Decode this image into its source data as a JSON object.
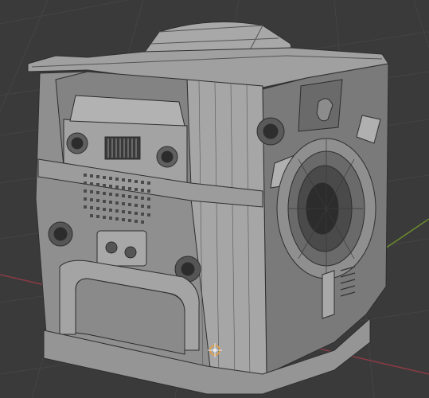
{
  "viewport": {
    "background": "#3a3a3a",
    "grid_color": "#444444",
    "axis_x_color": "#8a3b45",
    "axis_y_color": "#6b8a2e"
  },
  "model": {
    "body_color": "#9a9a9a",
    "body_light": "#b4b4b4",
    "body_dark": "#6e6e6e",
    "wire_color": "#2e2e2e"
  },
  "origin": {
    "icon": "object-origin-icon",
    "color": "#e8a040"
  }
}
